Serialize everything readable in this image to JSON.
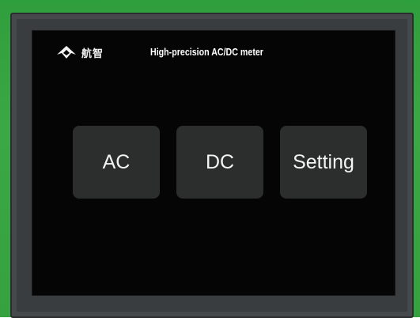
{
  "header": {
    "brand_name": "航智",
    "title": "High-precision AC/DC meter",
    "logo_icon": "bird-logo-icon"
  },
  "menu": {
    "ac_label": "AC",
    "dc_label": "DC",
    "setting_label": "Setting"
  },
  "colors": {
    "pcb_green": "#35a23f",
    "screen_background": "#050505",
    "button_background": "#2c2e2d",
    "text": "#f4f4f4"
  }
}
